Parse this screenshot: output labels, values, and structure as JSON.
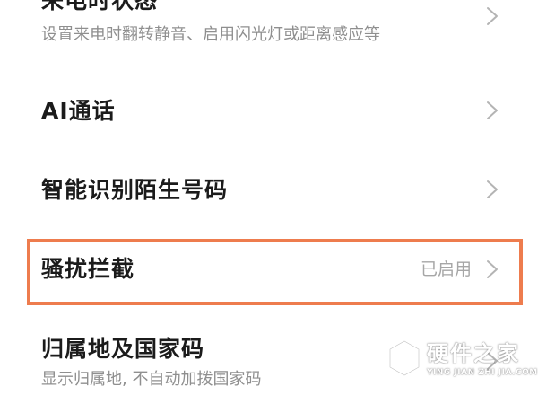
{
  "settings_list": {
    "items": [
      {
        "title": "来电时状态",
        "subtitle": "设置来电时翻转静音、启用闪光灯或距离感应等",
        "chevron_icon": "chevron-right-icon"
      },
      {
        "title": "AI通话",
        "chevron_icon": "chevron-right-icon"
      },
      {
        "title": "智能识别陌生号码",
        "chevron_icon": "chevron-right-icon"
      },
      {
        "title": "骚扰拦截",
        "value": "已启用",
        "chevron_icon": "chevron-right-icon",
        "highlighted": true
      },
      {
        "title": "归属地及国家码",
        "subtitle": "显示归属地, 不自动加拨国家码",
        "chevron_icon": "chevron-right-icon"
      }
    ]
  },
  "watermark": {
    "brand": "硬件之家",
    "pinyin": "YING JIAN ZHI JIA.COM",
    "logo_icon": "hexagon-logo-icon"
  },
  "colors": {
    "highlight_border": "#ee7c4e",
    "title_text": "#1b1b1b",
    "subtitle_text": "#8f8f8f",
    "value_text": "#a6a6a6",
    "chevron": "#b4b4b4"
  }
}
